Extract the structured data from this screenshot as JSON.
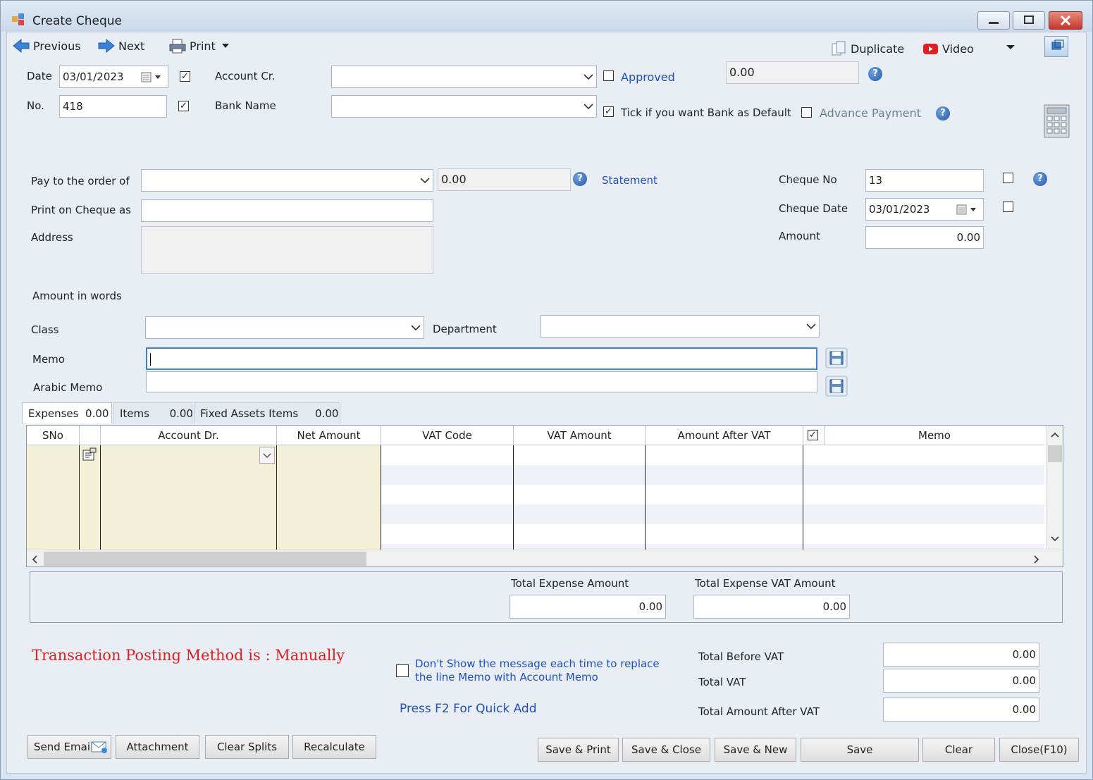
{
  "window": {
    "title": "Create Cheque"
  },
  "toolbar": {
    "previous": "Previous",
    "next": "Next",
    "print": "Print",
    "duplicate": "Duplicate",
    "video": "Video"
  },
  "header": {
    "date_label": "Date",
    "date_value": "03/01/2023",
    "no_label": "No.",
    "no_value": "418",
    "account_cr_label": "Account Cr.",
    "account_cr_value": "",
    "bank_name_label": "Bank Name",
    "bank_name_value": "",
    "approved_label": "Approved",
    "approved_amount": "0.00",
    "bank_default_label": "Tick if you want Bank as Default",
    "advance_payment_label": "Advance Payment"
  },
  "payee": {
    "pay_to_label": "Pay to the order of",
    "pay_to_value": "",
    "balance": "0.00",
    "statement_link": "Statement",
    "print_on_cheque_label": "Print on Cheque as",
    "print_on_cheque_value": "",
    "address_label": "Address",
    "amount_words_label": "Amount in words"
  },
  "cheque": {
    "no_label": "Cheque No",
    "no_value": "13",
    "date_label": "Cheque Date",
    "date_value": "03/01/2023",
    "amount_label": "Amount",
    "amount_value": "0.00"
  },
  "classification": {
    "class_label": "Class",
    "class_value": "",
    "department_label": "Department",
    "department_value": "",
    "memo_label": "Memo",
    "memo_value": "",
    "arabic_memo_label": "Arabic Memo",
    "arabic_memo_value": ""
  },
  "tabs": [
    {
      "label": "Expenses",
      "amount": "0.00"
    },
    {
      "label": "Items",
      "amount": "0.00"
    },
    {
      "label": "Fixed Assets Items",
      "amount": "0.00"
    }
  ],
  "grid": {
    "columns": [
      "SNo",
      "Account Dr.",
      "Net Amount",
      "VAT Code",
      "VAT Amount",
      "Amount After VAT",
      "Memo"
    ]
  },
  "expense_totals": {
    "total_expense_label": "Total Expense Amount",
    "total_expense_value": "0.00",
    "total_vat_label": "Total Expense VAT Amount",
    "total_vat_value": "0.00"
  },
  "footer": {
    "posting_method": "Transaction Posting Method is : Manually",
    "dont_show_msg": "Don't Show the message each time to replace the line Memo with Account Memo",
    "quick_add": "Press F2 For Quick Add",
    "total_before_vat_label": "Total Before VAT",
    "total_before_vat_value": "0.00",
    "total_vat_label": "Total VAT",
    "total_vat_value": "0.00",
    "total_after_vat_label": "Total Amount After VAT",
    "total_after_vat_value": "0.00"
  },
  "buttons": {
    "send_email": "Send Email",
    "attachment": "Attachment",
    "clear_splits": "Clear Splits",
    "recalculate": "Recalculate",
    "save_print": "Save & Print",
    "save_close": "Save & Close",
    "save_new": "Save & New",
    "save": "Save",
    "clear": "Clear",
    "close": "Close(F10)"
  },
  "colors": {
    "link": "#1f4fc4",
    "posting_method": "#e02020",
    "grid_editable": "#f4f0d8"
  }
}
